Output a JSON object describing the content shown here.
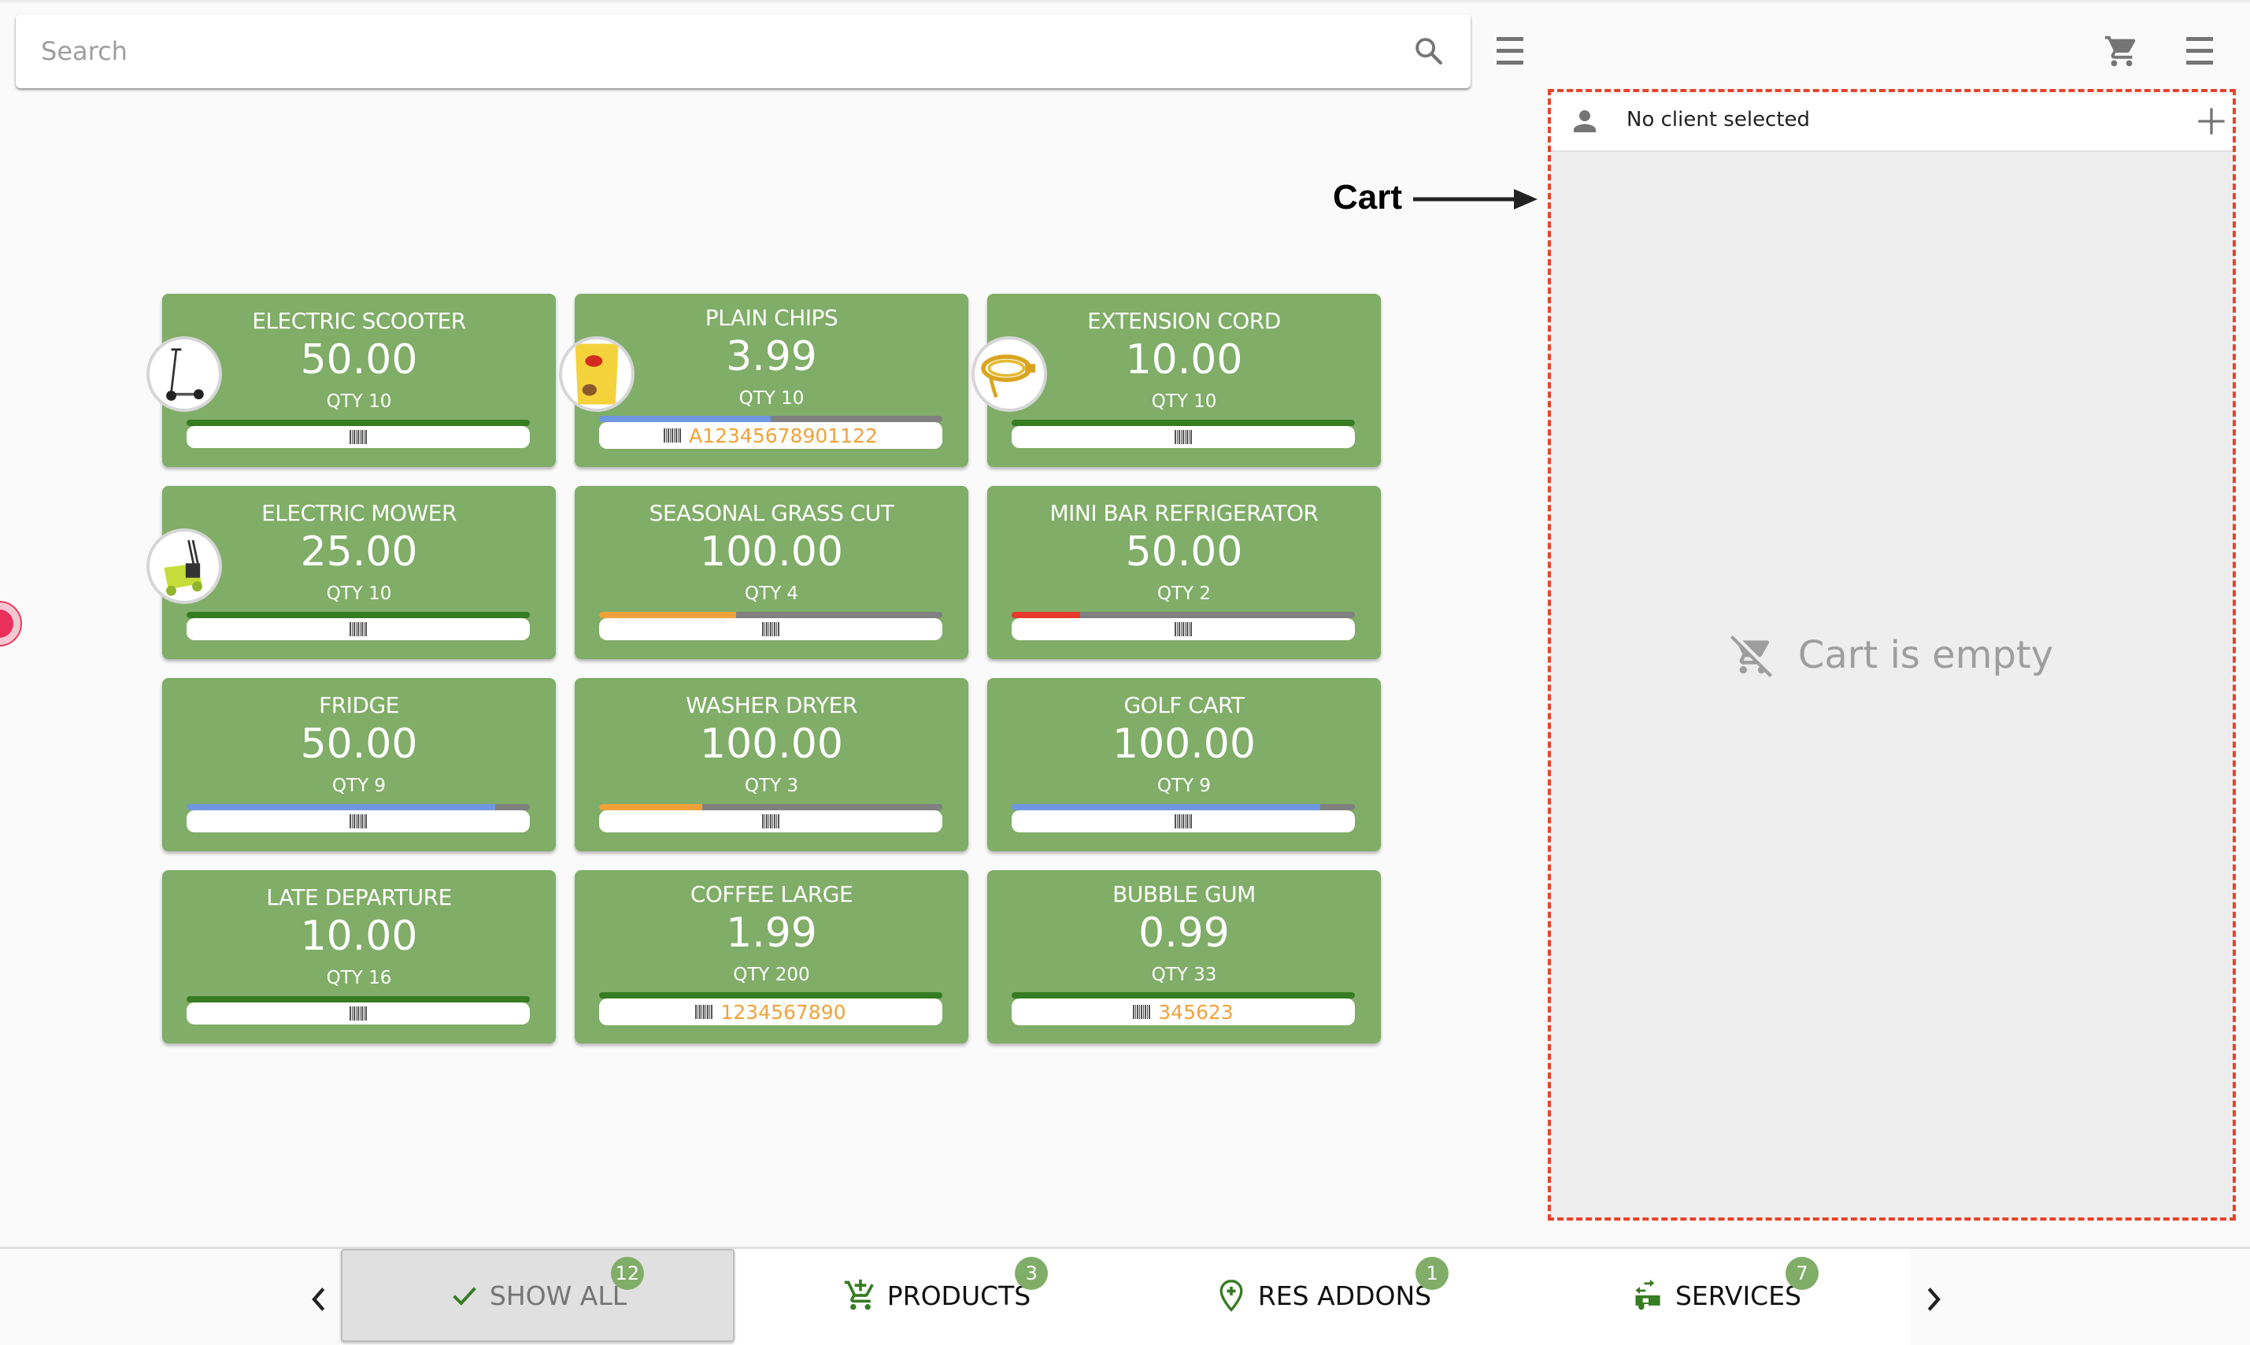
{
  "search": {
    "placeholder": "Search",
    "value": ""
  },
  "header": {
    "search_icon": "search-icon",
    "left_menu_icon": "hamburger-menu-icon",
    "cart_icon": "shopping-cart-icon",
    "right_menu_icon": "hamburger-menu-icon"
  },
  "cart": {
    "client_label": "No client selected",
    "client_icon": "person-icon",
    "add_client_icon": "plus-icon",
    "empty_text": "Cart is empty",
    "empty_icon": "remove-shopping-cart-icon"
  },
  "annotation": {
    "label": "Cart"
  },
  "colors": {
    "card_bg": "#80ad67",
    "stock_full": "#367c22",
    "stock_medium": "#6f98e1",
    "stock_low": "#f0a23a",
    "stock_critical": "#e8382b",
    "barcode_text": "#f0a23a",
    "annotation_outline": "#e8432b",
    "badge": "#80ad67"
  },
  "products": [
    {
      "name": "ELECTRIC SCOOTER",
      "price": "50.00",
      "qty": "QTY 10",
      "stock_fraction": 1.0,
      "stock_level": "full",
      "barcode": "",
      "image": "electric-scooter"
    },
    {
      "name": "PLAIN CHIPS",
      "price": "3.99",
      "qty": "QTY 10",
      "stock_fraction": 0.5,
      "stock_level": "medium",
      "barcode": "A12345678901122",
      "image": "potato-chips-bag"
    },
    {
      "name": "EXTENSION CORD",
      "price": "10.00",
      "qty": "QTY 10",
      "stock_fraction": 1.0,
      "stock_level": "full",
      "barcode": "",
      "image": "extension-cord"
    },
    {
      "name": "ELECTRIC MOWER",
      "price": "25.00",
      "qty": "QTY 10",
      "stock_fraction": 1.0,
      "stock_level": "full",
      "barcode": "",
      "image": "lawn-mower"
    },
    {
      "name": "SEASONAL GRASS CUT",
      "price": "100.00",
      "qty": "QTY 4",
      "stock_fraction": 0.4,
      "stock_level": "low",
      "barcode": "",
      "image": ""
    },
    {
      "name": "MINI BAR REFRIGERATOR",
      "price": "50.00",
      "qty": "QTY 2",
      "stock_fraction": 0.2,
      "stock_level": "critical",
      "barcode": "",
      "image": ""
    },
    {
      "name": "FRIDGE",
      "price": "50.00",
      "qty": "QTY 9",
      "stock_fraction": 0.9,
      "stock_level": "medium",
      "barcode": "",
      "image": ""
    },
    {
      "name": "WASHER DRYER",
      "price": "100.00",
      "qty": "QTY 3",
      "stock_fraction": 0.3,
      "stock_level": "low",
      "barcode": "",
      "image": ""
    },
    {
      "name": "GOLF CART",
      "price": "100.00",
      "qty": "QTY 9",
      "stock_fraction": 0.9,
      "stock_level": "medium",
      "barcode": "",
      "image": ""
    },
    {
      "name": "LATE DEPARTURE",
      "price": "10.00",
      "qty": "QTY 16",
      "stock_fraction": 1.0,
      "stock_level": "full",
      "barcode": "",
      "image": ""
    },
    {
      "name": "COFFEE LARGE",
      "price": "1.99",
      "qty": "QTY 200",
      "stock_fraction": 1.0,
      "stock_level": "full",
      "barcode": "1234567890",
      "image": ""
    },
    {
      "name": "BUBBLE GUM",
      "price": "0.99",
      "qty": "QTY 33",
      "stock_fraction": 1.0,
      "stock_level": "full",
      "barcode": "345623",
      "image": ""
    }
  ],
  "category_tabs": [
    {
      "label": "SHOW ALL",
      "count": "12",
      "icon": "check-icon",
      "active": true
    },
    {
      "label": "PRODUCTS",
      "count": "3",
      "icon": "add-shopping-cart-icon",
      "active": false
    },
    {
      "label": "RES ADDONS",
      "count": "1",
      "icon": "location-plus-icon",
      "active": false
    },
    {
      "label": "SERVICES",
      "count": "7",
      "icon": "rv-trailer-icon",
      "active": false
    }
  ],
  "nav": {
    "prev_icon": "chevron-left-icon",
    "next_icon": "chevron-right-icon"
  }
}
